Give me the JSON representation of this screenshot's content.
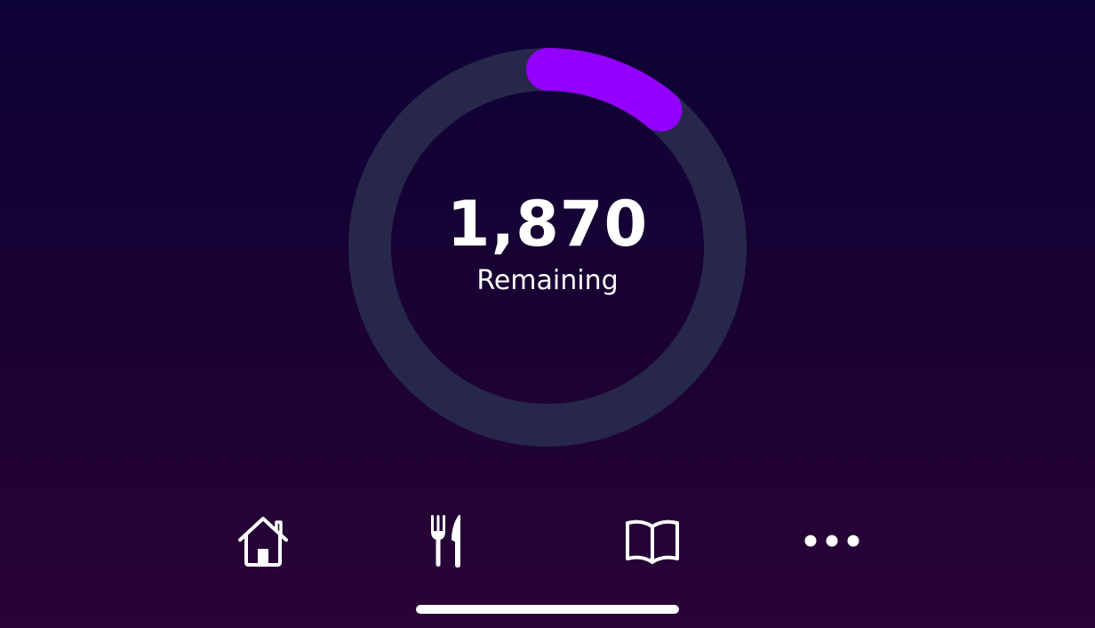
{
  "summary": {
    "value": "1,870",
    "label": "Remaining",
    "progress_fraction": 0.11,
    "track_color": "#27274b",
    "progress_color": "#9400ff"
  },
  "tabbar": {
    "tabs": [
      {
        "icon": "home-icon"
      },
      {
        "icon": "fork-knife-icon"
      },
      {
        "icon": "book-icon"
      },
      {
        "icon": "more-icon"
      }
    ]
  }
}
